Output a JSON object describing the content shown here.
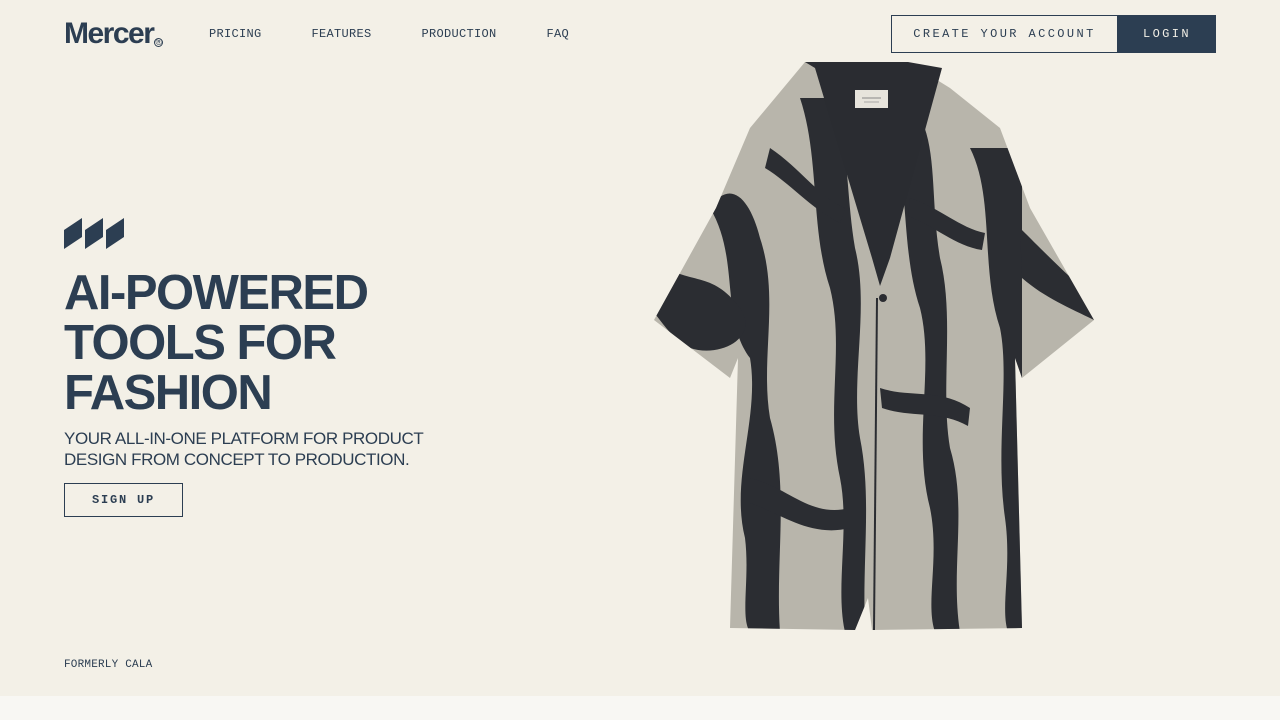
{
  "brand": {
    "name": "Mercer",
    "mark": "®"
  },
  "nav": {
    "items": [
      "PRICING",
      "FEATURES",
      "PRODUCTION",
      "FAQ"
    ]
  },
  "auth": {
    "create_account_label": "CREATE YOUR ACCOUNT",
    "login_label": "LOGIN"
  },
  "hero": {
    "icon": "slanted-bars-icon",
    "headline_lines": [
      "AI-POWERED",
      "TOOLS FOR",
      "FASHION"
    ],
    "subheadline_line1": "YOUR ALL-IN-ONE PLATFORM FOR PRODUCT",
    "subheadline_line2": "DESIGN FROM CONCEPT TO PRODUCTION.",
    "signup_label": "SIGN UP",
    "image_icon": "zebra-print-coat-image"
  },
  "footer_note": "FORMERLY CALA",
  "colors": {
    "background": "#f3f0e7",
    "primary": "#2c3e52",
    "garment_dark": "#2b2d32",
    "garment_light": "#b8b5ab"
  }
}
